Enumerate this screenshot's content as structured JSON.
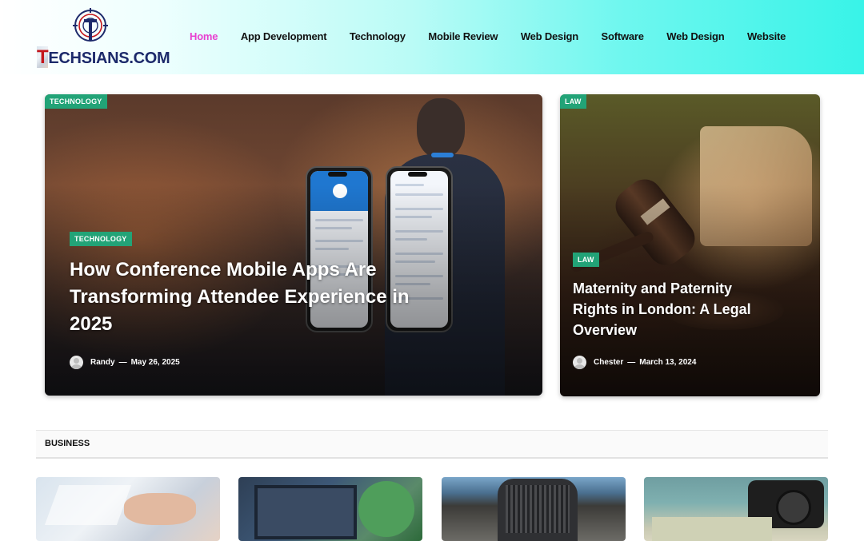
{
  "site": {
    "logo_text_prefix": "T",
    "logo_text_rest": "ECHSIANS.COM",
    "logo_icon": "target-t-logo-icon"
  },
  "nav": {
    "items": [
      {
        "label": "Home",
        "active": true
      },
      {
        "label": "App Development",
        "active": false
      },
      {
        "label": "Technology",
        "active": false
      },
      {
        "label": "Mobile Review",
        "active": false
      },
      {
        "label": "Web Design",
        "active": false
      },
      {
        "label": "Software",
        "active": false
      },
      {
        "label": "Web Design",
        "active": false
      },
      {
        "label": "Website",
        "active": false
      }
    ]
  },
  "hero": {
    "main": {
      "category_corner": "TECHNOLOGY",
      "category": "TECHNOLOGY",
      "title": "How Conference Mobile Apps Are Transforming Attendee Experience in 2025",
      "author": "Randy",
      "separator": "—",
      "date": "May 26, 2025"
    },
    "side": {
      "category_corner": "LAW",
      "category": "LAW",
      "title": "Maternity and Paternity Rights in London: A Legal Overview",
      "author": "Chester",
      "separator": "—",
      "date": "March 13, 2024"
    }
  },
  "section": {
    "title": "BUSINESS"
  },
  "colors": {
    "accent": "#e83fd0",
    "badge": "#22a377",
    "logo_red": "#c4161c",
    "logo_navy": "#1d2a6b"
  }
}
